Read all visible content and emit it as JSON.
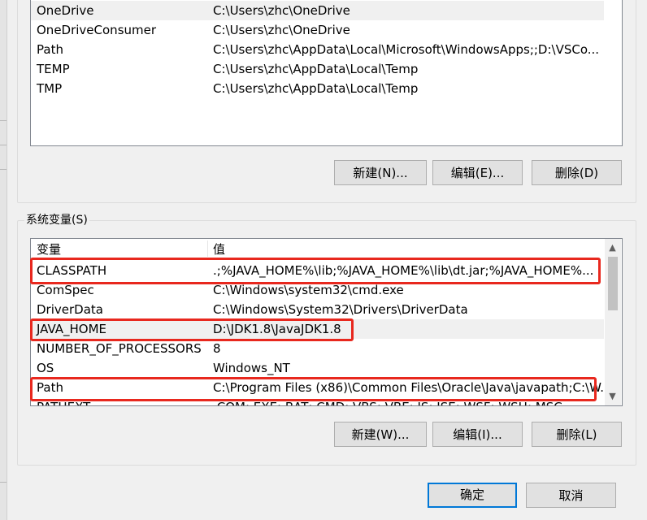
{
  "user_vars": {
    "rows": [
      {
        "name": "OneDrive",
        "value": "C:\\Users\\zhc\\OneDrive"
      },
      {
        "name": "OneDriveConsumer",
        "value": "C:\\Users\\zhc\\OneDrive"
      },
      {
        "name": "Path",
        "value": "C:\\Users\\zhc\\AppData\\Local\\Microsoft\\WindowsApps;;D:\\VSCo..."
      },
      {
        "name": "TEMP",
        "value": "C:\\Users\\zhc\\AppData\\Local\\Temp"
      },
      {
        "name": "TMP",
        "value": "C:\\Users\\zhc\\AppData\\Local\\Temp"
      }
    ],
    "buttons": {
      "new": "新建(N)...",
      "edit": "编辑(E)...",
      "delete": "删除(D)"
    }
  },
  "system_vars": {
    "group_label": "系统变量(S)",
    "header": {
      "name": "变量",
      "value": "值"
    },
    "rows": [
      {
        "name": "CLASSPATH",
        "value": ".;%JAVA_HOME%\\lib;%JAVA_HOME%\\lib\\dt.jar;%JAVA_HOME%..."
      },
      {
        "name": "ComSpec",
        "value": "C:\\Windows\\system32\\cmd.exe"
      },
      {
        "name": "DriverData",
        "value": "C:\\Windows\\System32\\Drivers\\DriverData"
      },
      {
        "name": "JAVA_HOME",
        "value": "D:\\JDK1.8\\JavaJDK1.8"
      },
      {
        "name": "NUMBER_OF_PROCESSORS",
        "value": "8"
      },
      {
        "name": "OS",
        "value": "Windows_NT"
      },
      {
        "name": "Path",
        "value": "C:\\Program Files (x86)\\Common Files\\Oracle\\Java\\javapath;C:\\W..."
      },
      {
        "name": "PATHEXT",
        "value": ".COM;.EXE;.BAT;.CMD;.VBS;.VBE;.JS;.JSE;.WSF;.WSH;.MSC"
      }
    ],
    "buttons": {
      "new": "新建(W)...",
      "edit": "编辑(I)...",
      "delete": "删除(L)"
    }
  },
  "dialog": {
    "ok": "确定",
    "cancel": "取消"
  },
  "colors": {
    "highlight_box": "#e8281e",
    "default_button_border": "#0078d7"
  }
}
